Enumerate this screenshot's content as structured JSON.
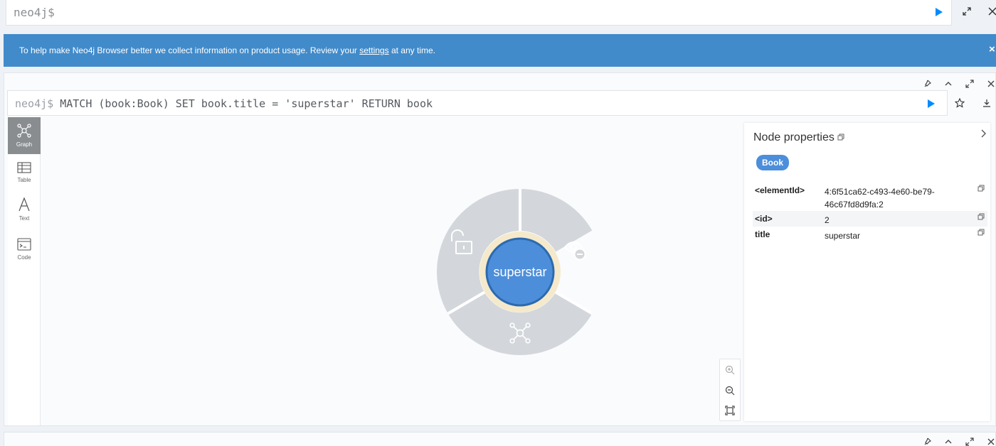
{
  "top_editor": {
    "prompt": "neo4j$"
  },
  "banner": {
    "text_before": "To help make Neo4j Browser better we collect information on product usage. Review your ",
    "link": "settings",
    "text_after": " at any time.",
    "close": "×"
  },
  "editor": {
    "prompt": "neo4j$",
    "query": " MATCH (book:Book) SET book.title = 'superstar' RETURN book"
  },
  "sidebar": {
    "items": [
      {
        "label": "Graph",
        "icon": "graph-icon",
        "active": true
      },
      {
        "label": "Table",
        "icon": "table-icon",
        "active": false
      },
      {
        "label": "Text",
        "icon": "text-icon",
        "active": false
      },
      {
        "label": "Code",
        "icon": "code-icon",
        "active": false
      }
    ]
  },
  "graph": {
    "node_caption": "superstar",
    "node_color": "#4c8eda",
    "ring_menu": [
      "lock-open-icon",
      "eye-hide-icon",
      "expand-graph-icon"
    ]
  },
  "properties": {
    "title": "Node properties",
    "label_badge": "Book",
    "rows": [
      {
        "key": "<elementId>",
        "value": "4:6f51ca62-c493-4e60-be79-46c67fd8d9fa:2"
      },
      {
        "key": "<id>",
        "value": "2"
      },
      {
        "key": "title",
        "value": "superstar"
      }
    ]
  },
  "colors": {
    "banner": "#428bca",
    "accent": "#018bff",
    "ring": "#d2d5d9"
  }
}
